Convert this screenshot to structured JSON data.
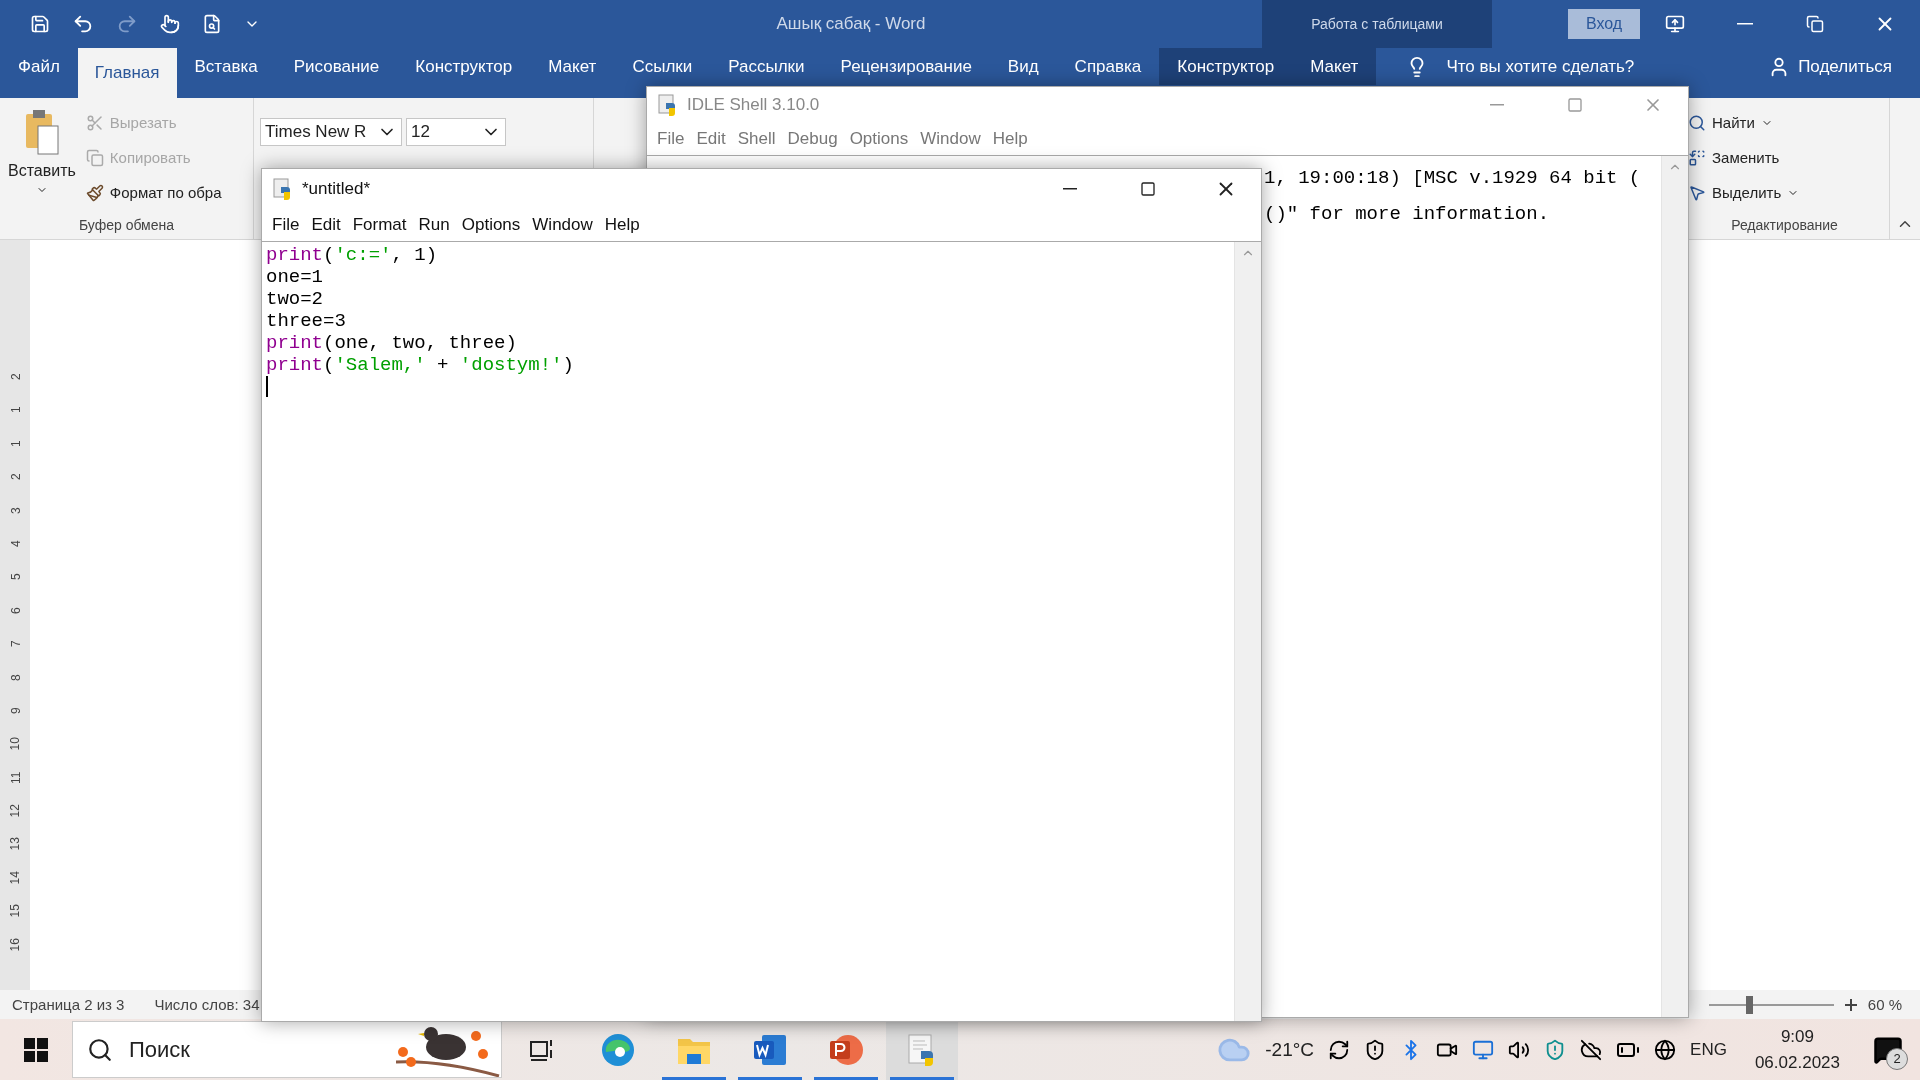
{
  "word": {
    "title": "Ашық сабақ  -  Word",
    "context_title": "Работа с таблицами",
    "sign_in": "Вход",
    "tabs": [
      {
        "label": "Файл",
        "selected": false,
        "kind": "normal"
      },
      {
        "label": "Главная",
        "selected": true,
        "kind": "normal"
      },
      {
        "label": "Вставка",
        "selected": false,
        "kind": "normal"
      },
      {
        "label": "Рисование",
        "selected": false,
        "kind": "normal"
      },
      {
        "label": "Конструктор",
        "selected": false,
        "kind": "normal"
      },
      {
        "label": "Макет",
        "selected": false,
        "kind": "normal"
      },
      {
        "label": "Ссылки",
        "selected": false,
        "kind": "normal"
      },
      {
        "label": "Рассылки",
        "selected": false,
        "kind": "normal"
      },
      {
        "label": "Рецензирование",
        "selected": false,
        "kind": "normal"
      },
      {
        "label": "Вид",
        "selected": false,
        "kind": "normal"
      },
      {
        "label": "Справка",
        "selected": false,
        "kind": "normal"
      },
      {
        "label": "Конструктор",
        "selected": false,
        "kind": "context"
      },
      {
        "label": "Макет",
        "selected": false,
        "kind": "context"
      }
    ],
    "tell_me": "Что вы хотите сделать?",
    "share": "Поделиться",
    "clipboard": {
      "paste": "Вставить",
      "group_label": "Буфер обмена",
      "items": [
        {
          "label": "Вырезать",
          "kind": "cut",
          "disabled": true
        },
        {
          "label": "Копировать",
          "kind": "copy",
          "disabled": true
        },
        {
          "label": "Формат по обра",
          "kind": "painter",
          "disabled": false
        }
      ]
    },
    "font": {
      "name": "Times New R",
      "size": "12"
    },
    "editing": {
      "group_label": "Редактирование",
      "items": [
        {
          "label": "Найти",
          "kind": "find",
          "dropdown": true
        },
        {
          "label": "Заменить",
          "kind": "replace",
          "dropdown": false
        },
        {
          "label": "Выделить",
          "kind": "select",
          "dropdown": true
        }
      ]
    },
    "ruler": [
      "2",
      "1",
      "1",
      "2",
      "3",
      "4",
      "5",
      "6",
      "7",
      "8",
      "9",
      "10",
      "11",
      "12",
      "13",
      "14",
      "15",
      "16"
    ],
    "status": {
      "page": "Страница 2 из 3",
      "words": "Число слов: 34",
      "zoom": {
        "level": 0.3,
        "reading": "60 %"
      }
    }
  },
  "shell": {
    "title": "IDLE Shell 3.10.0",
    "active": false,
    "menu": [
      "File",
      "Edit",
      "Shell",
      "Debug",
      "Options",
      "Window",
      "Help"
    ],
    "lines": [
      "1, 19:00:18) [MSC v.1929 64 bit (",
      "()\" for more information."
    ]
  },
  "editor": {
    "title": "*untitled*",
    "active": true,
    "menu": [
      "File",
      "Edit",
      "Format",
      "Run",
      "Options",
      "Window",
      "Help"
    ],
    "lines": [
      [
        {
          "kind": "builtin",
          "text": "print"
        },
        {
          "kind": "plain",
          "text": "("
        },
        {
          "kind": "string",
          "text": "'c:='"
        },
        {
          "kind": "plain",
          "text": ", 1)"
        }
      ],
      [
        {
          "kind": "plain",
          "text": "one=1"
        }
      ],
      [
        {
          "kind": "plain",
          "text": "two=2"
        }
      ],
      [
        {
          "kind": "plain",
          "text": "three=3"
        }
      ],
      [
        {
          "kind": "builtin",
          "text": "print"
        },
        {
          "kind": "plain",
          "text": "(one, two, three)"
        }
      ],
      [
        {
          "kind": "builtin",
          "text": "print"
        },
        {
          "kind": "plain",
          "text": "("
        },
        {
          "kind": "string",
          "text": "'Salem,'"
        },
        {
          "kind": "plain",
          "text": " + "
        },
        {
          "kind": "string",
          "text": "'dostym!'"
        },
        {
          "kind": "plain",
          "text": ")"
        }
      ]
    ]
  },
  "taskbar": {
    "search": "Поиск",
    "apps": [
      {
        "kind": "taskview",
        "running": false,
        "selected": false
      },
      {
        "kind": "edge",
        "running": false,
        "selected": false
      },
      {
        "kind": "explorer",
        "running": true,
        "selected": false
      },
      {
        "kind": "word",
        "running": true,
        "selected": false
      },
      {
        "kind": "powerpoint",
        "running": true,
        "selected": false
      },
      {
        "kind": "idle",
        "running": true,
        "selected": true
      }
    ],
    "temperature": "-21°C",
    "language": "ENG",
    "time": "9:09",
    "date": "06.02.2023",
    "notifications": "2"
  }
}
